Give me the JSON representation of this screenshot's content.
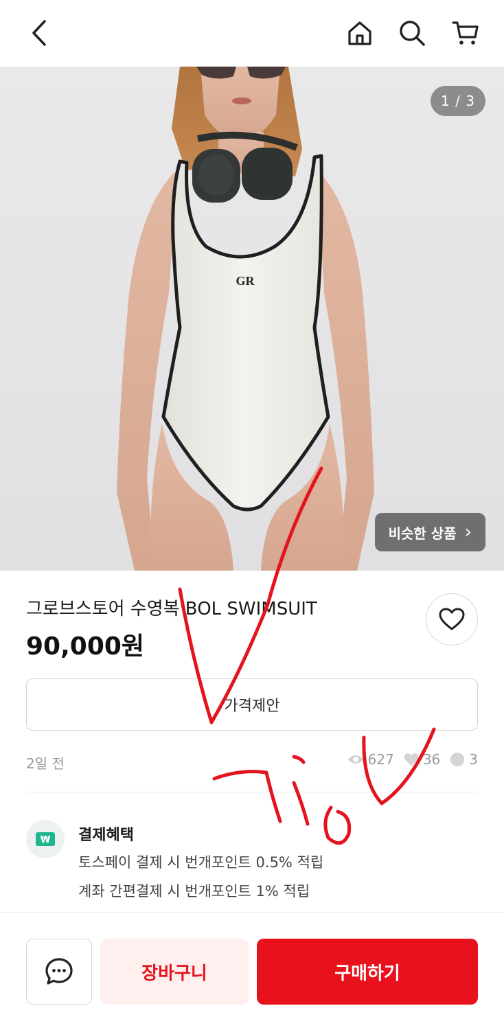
{
  "header": {
    "back_icon": "chevron-left-icon",
    "home_icon": "home-icon",
    "search_icon": "search-icon",
    "cart_icon": "cart-icon"
  },
  "gallery": {
    "counter": "1 / 3",
    "similar_label": "비슷한 상품",
    "similar_arrow": "›",
    "logo_text": "GR"
  },
  "product": {
    "title": "그로브스토어 수영복 BOL SWIMSUIT",
    "price": "90,000원",
    "wish_icon": "heart-outline-icon"
  },
  "offer": {
    "label": "가격제안"
  },
  "meta": {
    "time_ago": "2일 전",
    "views": "627",
    "likes": "36",
    "chats": "3"
  },
  "benefit": {
    "title": "결제혜택",
    "line1": "토스페이 결제 시 번개포인트 0.5% 적립",
    "line2": "계좌 간편결제 시 번개포인트 1% 적립",
    "icon_symbol": "₩"
  },
  "actions": {
    "chat_icon": "chat-bubble-icon",
    "cart_label": "장바구니",
    "buy_label": "구매하기"
  },
  "colors": {
    "accent_red": "#e8111c",
    "cart_bg": "#fff0ef",
    "benefit_green": "#1fb58f",
    "scribble_red": "#e3141e"
  }
}
